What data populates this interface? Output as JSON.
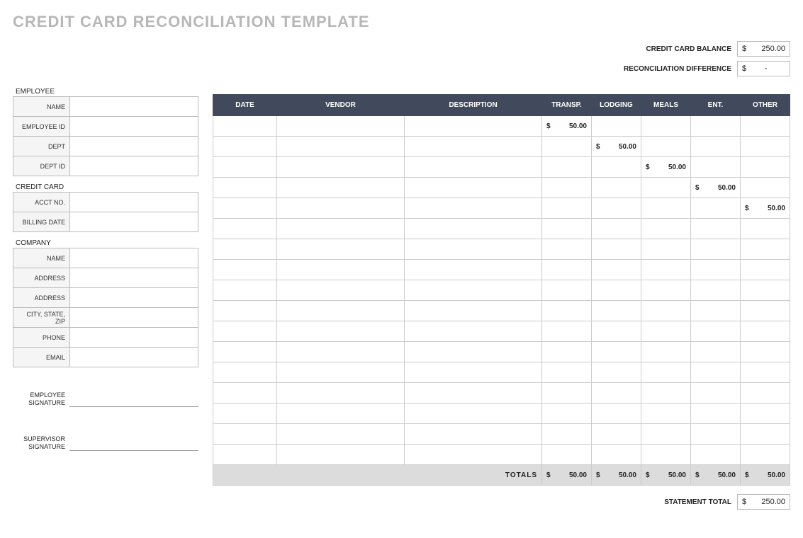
{
  "title": "CREDIT CARD RECONCILIATION TEMPLATE",
  "summary": {
    "balance_label": "CREDIT CARD BALANCE",
    "balance_currency": "$",
    "balance_value": "250.00",
    "diff_label": "RECONCILIATION DIFFERENCE",
    "diff_currency": "$",
    "diff_value": "-"
  },
  "sections": {
    "employee_label": "EMPLOYEE",
    "employee_fields": [
      "NAME",
      "EMPLOYEE ID",
      "DEPT",
      "DEPT ID"
    ],
    "creditcard_label": "CREDIT CARD",
    "creditcard_fields": [
      "ACCT NO.",
      "BILLING DATE"
    ],
    "company_label": "COMPANY",
    "company_fields": [
      "NAME",
      "ADDRESS",
      "ADDRESS",
      "CITY, STATE, ZIP",
      "PHONE",
      "EMAIL"
    ],
    "employee_sig": "EMPLOYEE SIGNATURE",
    "supervisor_sig": "SUPERVISOR SIGNATURE"
  },
  "grid": {
    "headers": [
      "DATE",
      "VENDOR",
      "DESCRIPTION",
      "TRANSP.",
      "LODGING",
      "MEALS",
      "ENT.",
      "OTHER"
    ],
    "rows": [
      {
        "transp": "50.00"
      },
      {
        "lodging": "50.00"
      },
      {
        "meals": "50.00"
      },
      {
        "ent": "50.00"
      },
      {
        "other": "50.00"
      },
      {},
      {},
      {},
      {},
      {},
      {},
      {},
      {},
      {},
      {},
      {},
      {}
    ],
    "totals_label": "TOTALS",
    "totals": {
      "transp": "50.00",
      "lodging": "50.00",
      "meals": "50.00",
      "ent": "50.00",
      "other": "50.00"
    }
  },
  "statement": {
    "label": "STATEMENT TOTAL",
    "currency": "$",
    "value": "250.00"
  },
  "currency_symbol": "$"
}
